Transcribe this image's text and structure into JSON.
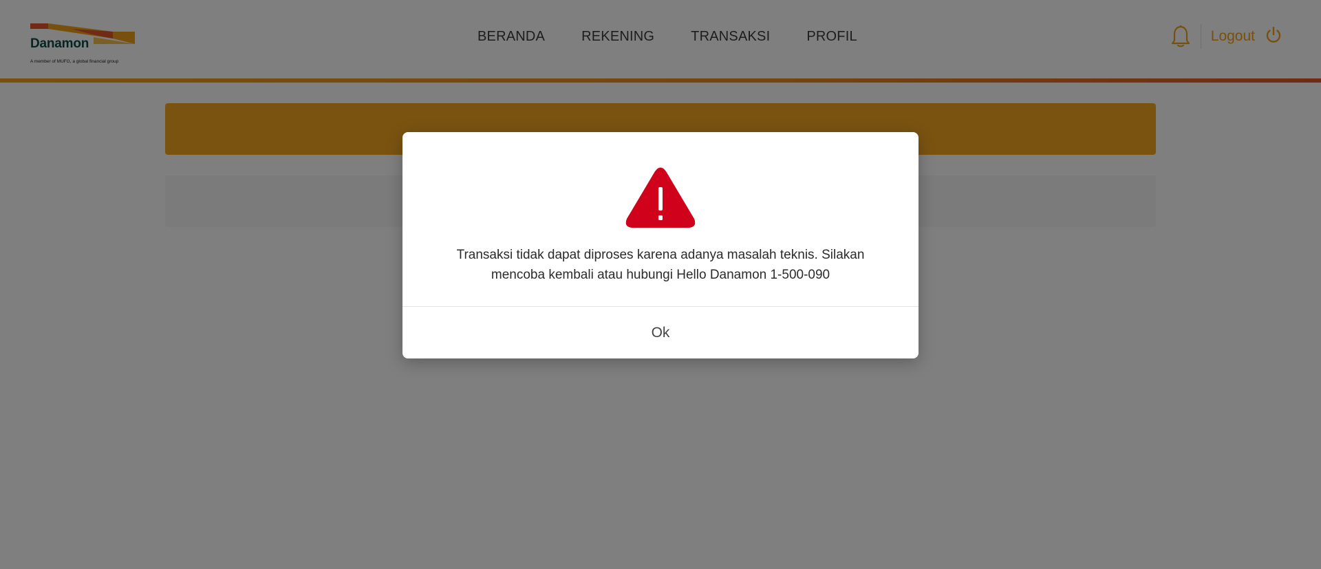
{
  "header": {
    "logo": {
      "brand_name": "Danamon",
      "tagline": "A member of MUFG, a global financial group"
    },
    "nav": [
      {
        "label": "BERANDA"
      },
      {
        "label": "REKENING"
      },
      {
        "label": "TRANSAKSI"
      },
      {
        "label": "PROFIL"
      }
    ],
    "notifications_icon": "bell-icon",
    "logout_label": "Logout",
    "logout_icon": "power-icon"
  },
  "colors": {
    "accent": "#f0a11b",
    "banner": "#f5a623",
    "alert_red": "#d0021b",
    "brand_teal": "#0b4a4a"
  },
  "modal": {
    "icon": "warning-icon",
    "message": "Transaksi tidak dapat diproses karena adanya masalah teknis. Silakan mencoba kembali atau hubungi Hello Danamon 1-500-090",
    "ok_label": "Ok"
  }
}
